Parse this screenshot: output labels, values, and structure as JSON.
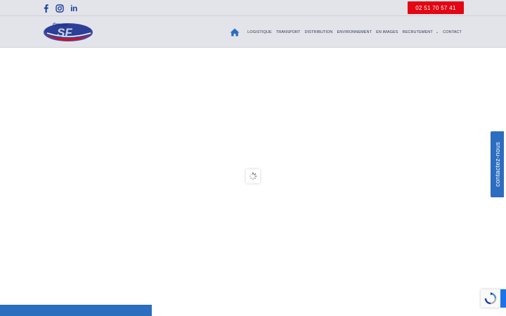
{
  "topbar": {
    "social": [
      {
        "name": "facebook",
        "icon": "facebook-icon"
      },
      {
        "name": "instagram",
        "icon": "instagram-icon"
      },
      {
        "name": "linkedin",
        "icon": "linkedin-icon",
        "text": "in"
      }
    ],
    "phone_label": "02 51 70 57 41",
    "phone_color": "#e30613"
  },
  "header": {
    "logo": {
      "text_top": "Groupe",
      "text_main": "SF"
    },
    "nav": {
      "home_icon": "home-icon",
      "items": [
        {
          "label": "LOGISTIQUE"
        },
        {
          "label": "TRANSPORT"
        },
        {
          "label": "DISTRIBUTION"
        },
        {
          "label": "ENVIRONNEMENT"
        },
        {
          "label": "EN IMAGES"
        },
        {
          "label": "RECRUTEMENT",
          "has_dropdown": true,
          "dropdown_icon": "chevron-down-icon"
        },
        {
          "label": "CONTACT"
        }
      ]
    }
  },
  "loader": {
    "icon": "spinner-icon"
  },
  "contact_tab": {
    "label": "contactez-nous",
    "color": "#2b6dbf"
  },
  "recaptcha": {
    "icon": "recaptcha-icon"
  },
  "colors": {
    "header_bg": "#e3e4e9",
    "nav_text": "#2c3655",
    "accent_blue": "#2b6dbf"
  }
}
